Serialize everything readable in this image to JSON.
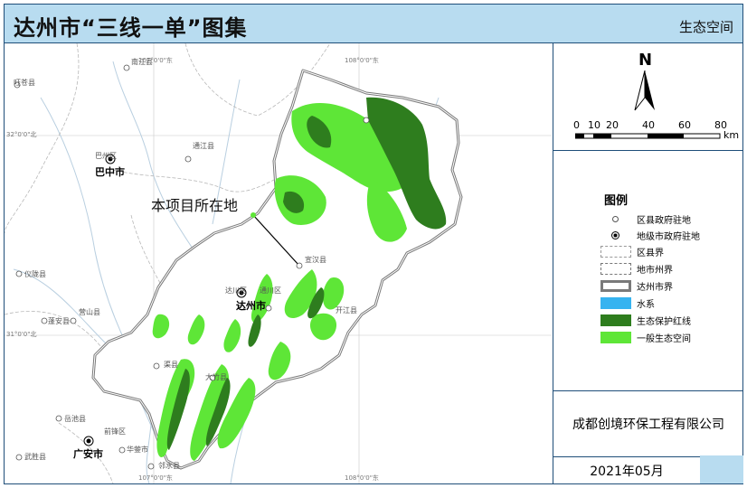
{
  "header": {
    "title": "达州市“三线一单”图集",
    "subtitle": "生态空间"
  },
  "map": {
    "callout": "本项目所在地",
    "cities": [
      "达州市",
      "巴中市",
      "广安市"
    ],
    "counties": [
      "南江县",
      "巴州区",
      "通江县",
      "旺苍县",
      "仪陇县",
      "营山县",
      "蓬安县",
      "渠县",
      "大竹县",
      "邻水县",
      "华蓥市",
      "前锋区",
      "岳池县",
      "武胜县",
      "达川区",
      "通川区",
      "开江县",
      "宣汉县"
    ],
    "graticule": [
      "107°0'0\"东",
      "108°0'0\"东",
      "32°0'0\"北",
      "31°0'0\"北"
    ],
    "colors": {
      "protection_red_line": "#2e7d1e",
      "general_eco_space": "#5ee637",
      "boundary": "#7a7a7a"
    }
  },
  "compass": {
    "north": "N"
  },
  "scale": {
    "ticks": [
      "0",
      "10",
      "20",
      "40",
      "60",
      "80"
    ],
    "unit": "km"
  },
  "legend": {
    "title": "图例",
    "items": [
      {
        "label": "区县政府驻地"
      },
      {
        "label": "地级市政府驻地"
      },
      {
        "label": "区县界"
      },
      {
        "label": "地市州界"
      },
      {
        "label": "达州市界"
      },
      {
        "label": "水系"
      },
      {
        "label": "生态保护红线"
      },
      {
        "label": "一般生态空间"
      }
    ]
  },
  "footer": {
    "company": "成都创境环保工程有限公司",
    "date": "2021年05月"
  }
}
